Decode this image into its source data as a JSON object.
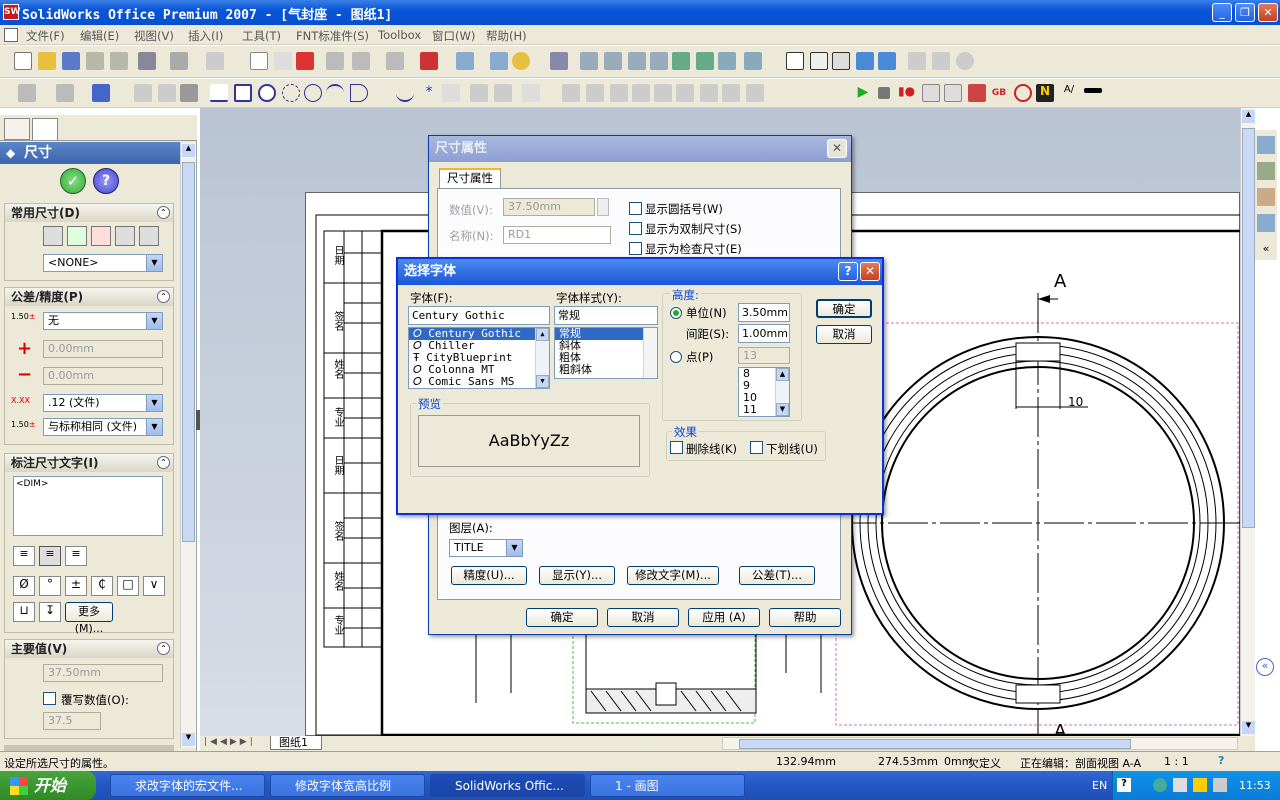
{
  "window": {
    "title": "SolidWorks Office Premium 2007 - [气封座 - 图纸1]",
    "app_icon": "SW"
  },
  "menu": [
    "文件(F)",
    "编辑(E)",
    "视图(V)",
    "插入(I)",
    "工具(T)",
    "FNT标准件(S)",
    "Toolbox",
    "窗口(W)",
    "帮助(H)"
  ],
  "panel": {
    "header": "尺寸",
    "sections": {
      "common": {
        "title": "常用尺寸(D)",
        "select": "<NONE>"
      },
      "tolerance": {
        "title": "公差/精度(P)",
        "tol_type": "无",
        "plus": "0.00mm",
        "minus": "0.00mm",
        "precision": ".12 (文件)",
        "tol_precision": "与标称相同 (文件)"
      },
      "text": {
        "title": "标注尺寸文字(I)",
        "content": "<DIM>",
        "more": "更多(M)..."
      },
      "primary": {
        "title": "主要值(V)",
        "value": "37.50mm",
        "override_label": "覆写数值(O):",
        "override_value": "37.5"
      }
    }
  },
  "sheet_tab": "图纸1",
  "drawing": {
    "section_label_top": "A",
    "section_label_bottom": "A",
    "dim_text": "10"
  },
  "dim_dialog": {
    "title": "尺寸属性",
    "tab": "尺寸属性",
    "value_label": "数值(V):",
    "value": "37.50mm",
    "name_label": "名称(N):",
    "name": "RD1",
    "fullname_label": "全名(L):",
    "check1": "显示圆括号(W)",
    "check2": "显示为双制尺寸(S)",
    "check3": "显示为检查尺寸(E)",
    "layer_label": "图层(A):",
    "layer": "TITLE",
    "btn_precision": "精度(U)...",
    "btn_display": "显示(Y)...",
    "btn_modify": "修改文字(M)...",
    "btn_tol": "公差(T)...",
    "btn_ok": "确定",
    "btn_cancel": "取消",
    "btn_apply": "应用 (A)",
    "btn_help": "帮助"
  },
  "font_dialog": {
    "title": "选择字体",
    "font_label": "字体(F):",
    "font_value": "Century Gothic",
    "fonts": [
      "Century Gothic",
      "Chiller",
      "CityBlueprint",
      "Colonna MT",
      "Comic Sans MS"
    ],
    "style_label": "字体样式(Y):",
    "style_value": "常规",
    "styles": [
      "常规",
      "斜体",
      "粗体",
      "粗斜体"
    ],
    "height_group": "高度:",
    "unit_label": "单位(N)",
    "unit_value": "3.50mm",
    "spacing_label": "间距(S):",
    "spacing_value": "1.00mm",
    "point_label": "点(P)",
    "point_value": "13",
    "points": [
      "8",
      "9",
      "10",
      "11"
    ],
    "preview_group": "预览",
    "preview_text": "AaBbYyZz",
    "effect_group": "效果",
    "strike": "删除线(K)",
    "underline": "下划线(U)",
    "ok": "确定",
    "cancel": "取消"
  },
  "status": {
    "hint": "设定所选尺寸的属性。",
    "x": "132.94mm",
    "y": "274.53mm",
    "z": "0mm",
    "state": "欠定义",
    "edit": "正在编辑：剖面视图 A-A",
    "scale": "1 : 1"
  },
  "taskbar": {
    "start": "开始",
    "tasks": [
      "求改字体的宏文件...",
      "修改字体宽高比例",
      "SolidWorks Offic...",
      "1 - 画图"
    ],
    "lang": "EN",
    "time": "11:53"
  },
  "title_block_cells": [
    "日期",
    "签名",
    "姓名",
    "专业",
    "日期",
    "签名",
    "姓名",
    "专业"
  ]
}
